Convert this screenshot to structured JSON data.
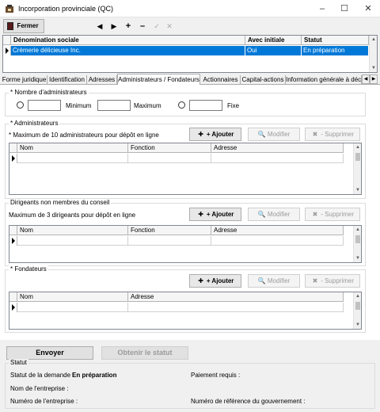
{
  "window": {
    "title": "Incorporation provinciale (QC)"
  },
  "toolbar": {
    "fermer_label": "Fermer"
  },
  "main_grid": {
    "columns": [
      "Dénomination sociale",
      "Avec initiale",
      "Statut"
    ],
    "rows": [
      {
        "denomination": "Crèmerie délicieuse Inc.",
        "initiale": "Oui",
        "statut": "En préparation"
      }
    ]
  },
  "tabs": [
    {
      "label": "Forme juridique"
    },
    {
      "label": "Identification"
    },
    {
      "label": "Adresses"
    },
    {
      "label": "Administrateurs / Fondateurs"
    },
    {
      "label": "Actionnaires"
    },
    {
      "label": "Capital-actions"
    },
    {
      "label": "Information générale à décl"
    }
  ],
  "nombre_admin": {
    "title": "* Nombre d'administrateurs",
    "minimum_label": "Minimum",
    "maximum_label": "Maximum",
    "fixe_label": "Fixe"
  },
  "administrateurs": {
    "title": "* Administrateurs",
    "note": "* Maximum de 10 administrateurs pour dépôt en ligne",
    "columns": [
      "Nom",
      "Fonction",
      "Adresse"
    ]
  },
  "dirigeants": {
    "title": "Dirigeants non membres du conseil",
    "note": "Maximum de 3 dirigeants pour dépôt en ligne",
    "columns": [
      "Nom",
      "Fonction",
      "Adresse"
    ]
  },
  "fondateurs": {
    "title": "* Fondateurs",
    "columns": [
      "Nom",
      "Adresse"
    ]
  },
  "buttons": {
    "ajouter": "Ajouter",
    "modifier": "Modifier",
    "supprimer": "Supprimer",
    "envoyer": "Envoyer",
    "obtenir_statut": "Obtenir le statut"
  },
  "statut": {
    "title": "Statut",
    "demande_label": "Statut de la demande :",
    "demande_value": "En préparation",
    "paiement_label": "Paiement requis :",
    "nom_label": "Nom de l'entreprise :",
    "numero_label": "Numéro de l'entreprise :",
    "reference_label": "Numéro de référence du gouvernement :"
  }
}
